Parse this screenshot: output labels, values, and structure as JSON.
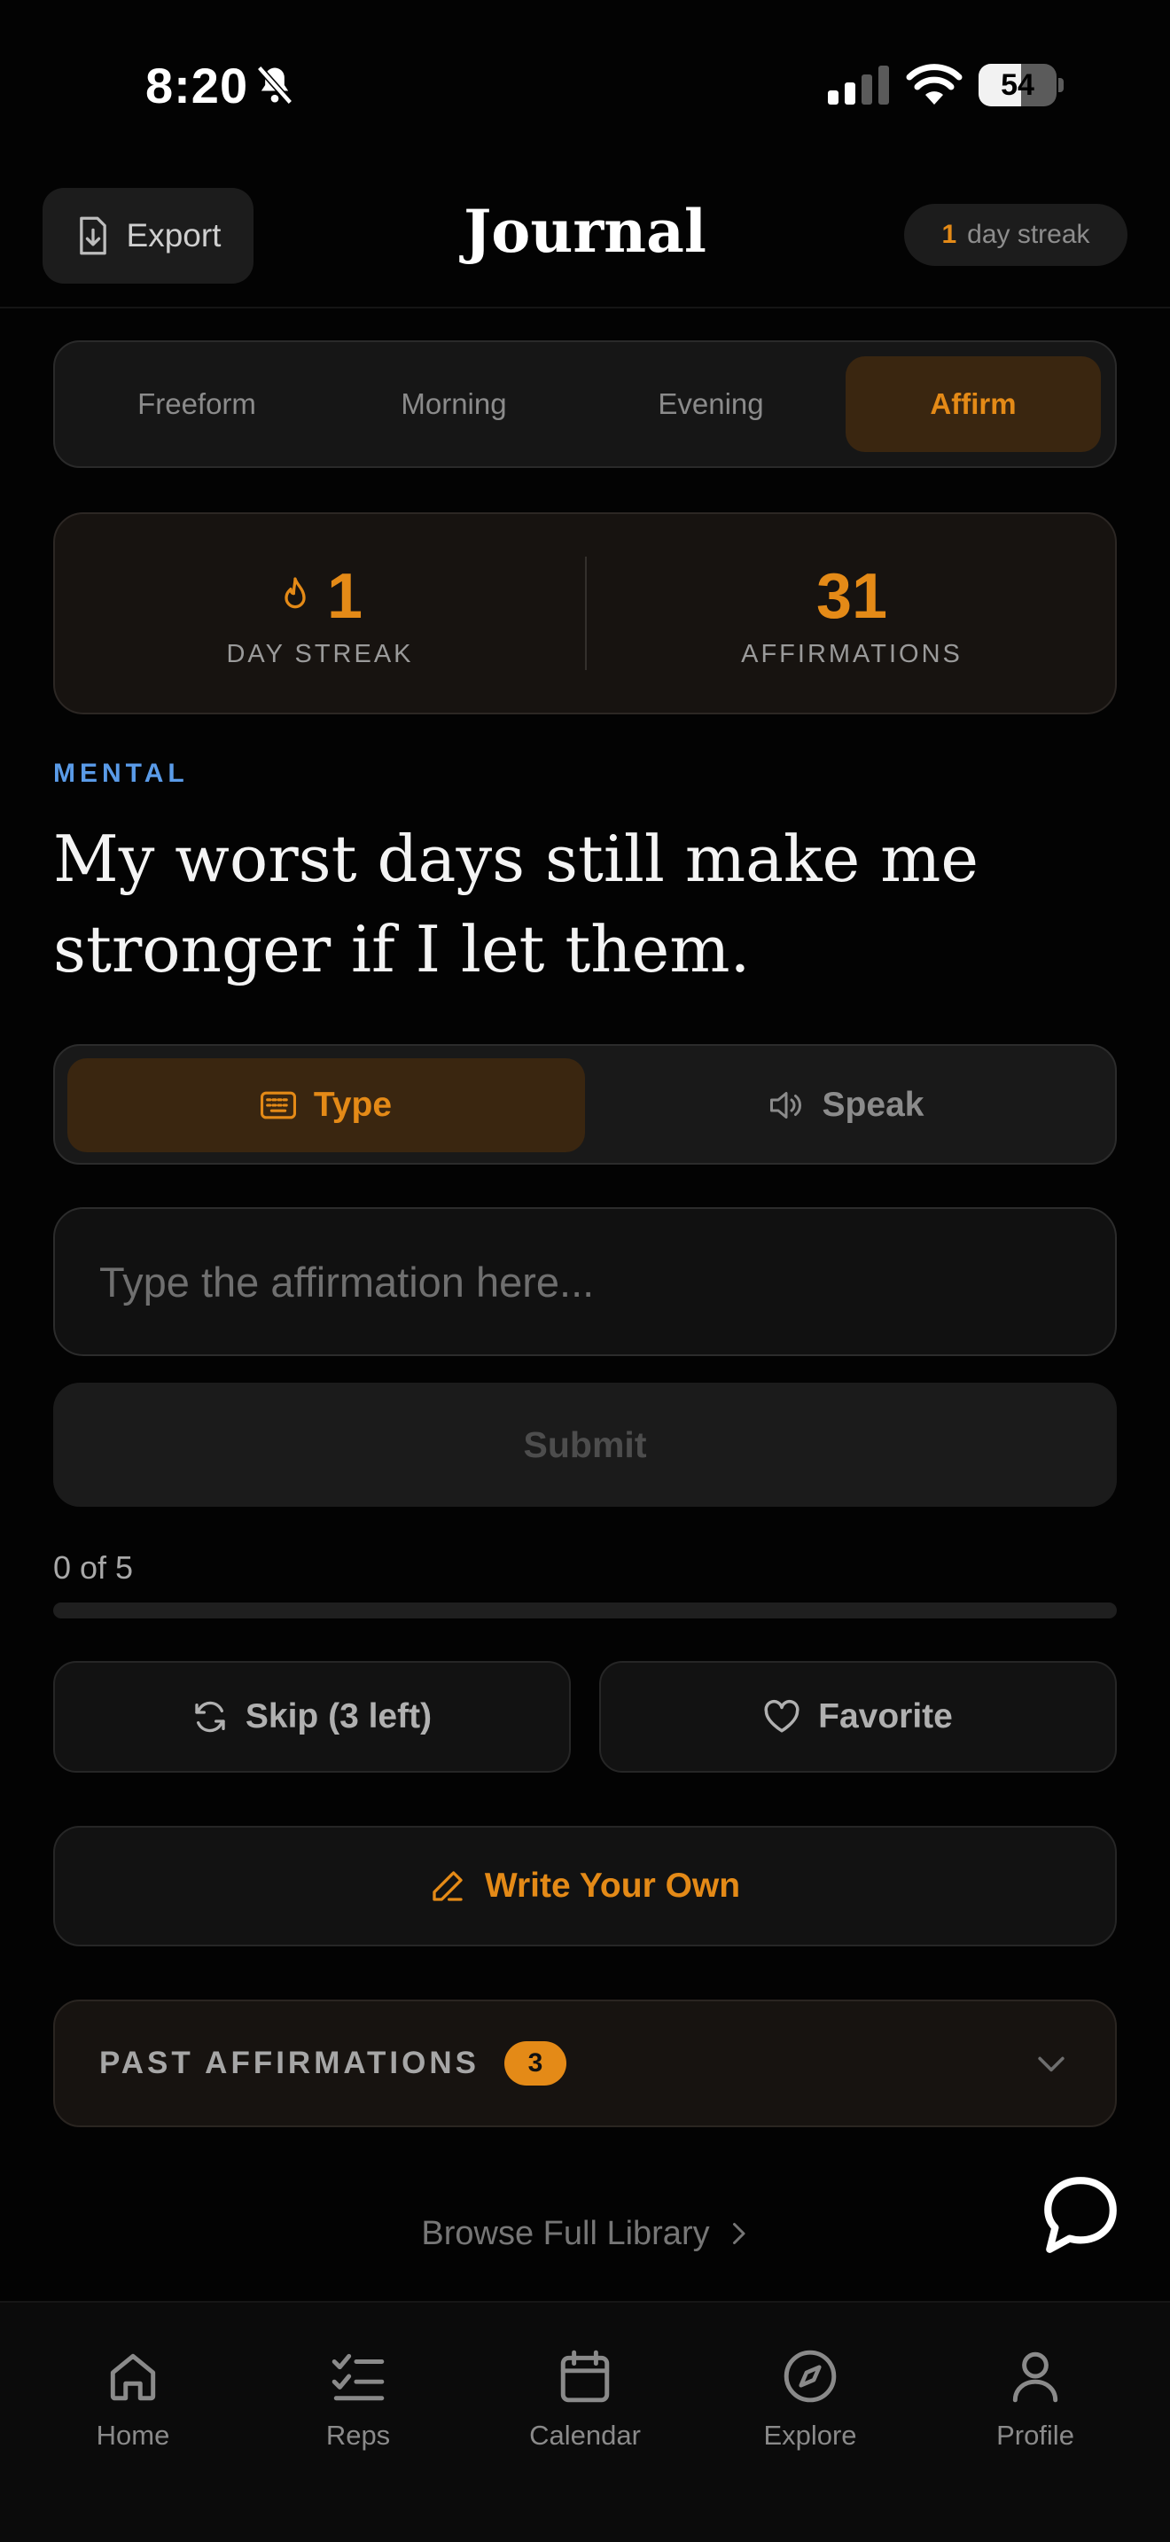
{
  "status_bar": {
    "time": "8:20",
    "battery": "54",
    "battery_fraction": 0.54
  },
  "header": {
    "export_label": "Export",
    "title": "Journal",
    "streak_count": "1",
    "streak_label": "day streak"
  },
  "mode_tabs": [
    {
      "label": "Freeform",
      "active": false
    },
    {
      "label": "Morning",
      "active": false
    },
    {
      "label": "Evening",
      "active": false
    },
    {
      "label": "Affirm",
      "active": true
    }
  ],
  "stats": {
    "streak_value": "1",
    "streak_label": "DAY STREAK",
    "affirmations_value": "31",
    "affirmations_label": "AFFIRMATIONS"
  },
  "affirmation": {
    "category": "MENTAL",
    "text": "My worst days still make me stronger if I let them."
  },
  "input_mode": {
    "type_label": "Type",
    "speak_label": "Speak",
    "selected": "Type"
  },
  "input": {
    "placeholder": "Type the affirmation here...",
    "value": ""
  },
  "submit_label": "Submit",
  "progress": {
    "text": "0 of 5",
    "completed": 0,
    "total": 5
  },
  "actions": {
    "skip_label": "Skip (3 left)",
    "favorite_label": "Favorite"
  },
  "write_own_label": "Write Your Own",
  "past": {
    "title": "PAST AFFIRMATIONS",
    "count": "3"
  },
  "browse_label": "Browse Full Library",
  "tab_bar": [
    {
      "label": "Home",
      "icon": "home-icon"
    },
    {
      "label": "Reps",
      "icon": "checklist-icon"
    },
    {
      "label": "Calendar",
      "icon": "calendar-icon"
    },
    {
      "label": "Explore",
      "icon": "compass-icon"
    },
    {
      "label": "Profile",
      "icon": "person-icon"
    }
  ],
  "colors": {
    "accent": "#e48a17",
    "category": "#5a9be8",
    "background": "#030303"
  }
}
